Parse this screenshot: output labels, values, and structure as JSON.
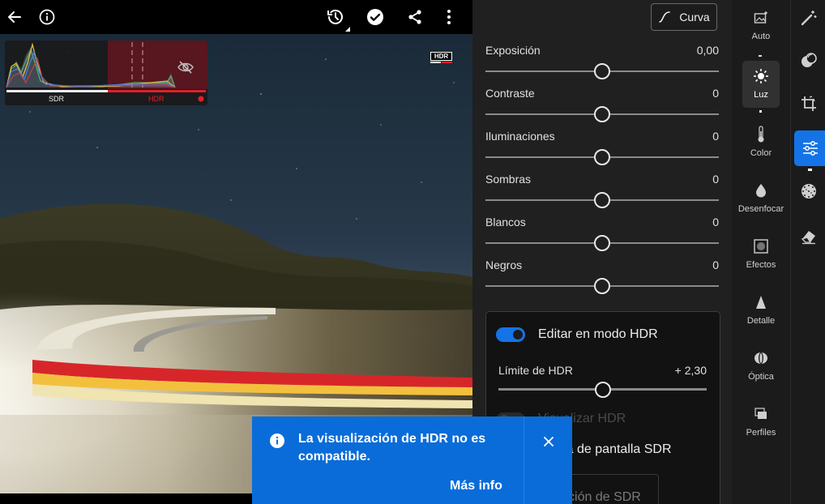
{
  "topbar": {
    "icons": [
      "back-arrow-icon",
      "info-icon",
      "history-icon",
      "check-circle-icon",
      "share-icon",
      "more-vertical-icon"
    ]
  },
  "histogram": {
    "sdr_label": "SDR",
    "hdr_label": "HDR"
  },
  "photo": {
    "hdr_badge": "HDR"
  },
  "panel": {
    "curve_button": "Curva",
    "sliders": [
      {
        "label": "Exposición",
        "value": "0,00",
        "position": 0.5
      },
      {
        "label": "Contraste",
        "value": "0",
        "position": 0.5
      },
      {
        "label": "Iluminaciones",
        "value": "0",
        "position": 0.5
      },
      {
        "label": "Sombras",
        "value": "0",
        "position": 0.5
      },
      {
        "label": "Blancos",
        "value": "0",
        "position": 0.5
      },
      {
        "label": "Negros",
        "value": "0",
        "position": 0.5
      }
    ],
    "hdr_section": {
      "edit_toggle_label": "Editar en modo HDR",
      "edit_toggle_on": true,
      "limit_label": "Límite de HDR",
      "limit_value": "+ 2,30",
      "limit_position": 0.5,
      "visualize_label": "Visualizar HDR",
      "preview_label": "previa de pantalla SDR",
      "preview_button": "ación de SDR"
    }
  },
  "tool_strip": {
    "items": [
      {
        "label": "Auto",
        "icon": "auto-photo-icon",
        "active": false
      },
      {
        "label": "Luz",
        "icon": "sun-icon",
        "active": true
      },
      {
        "label": "Color",
        "icon": "thermometer-icon",
        "active": false
      },
      {
        "label": "Desenfocar",
        "icon": "droplet-icon",
        "active": false
      },
      {
        "label": "Efectos",
        "icon": "vignette-icon",
        "active": false
      },
      {
        "label": "Detalle",
        "icon": "triangle-icon",
        "active": false
      },
      {
        "label": "Óptica",
        "icon": "lens-icon",
        "active": false
      },
      {
        "label": "Perfiles",
        "icon": "profiles-icon",
        "active": false
      }
    ]
  },
  "rail": {
    "icons": [
      "magic-wand-icon",
      "masking-icon",
      "crop-icon",
      "edit-sliders-icon",
      "presets-icon",
      "eraser-icon"
    ],
    "active_index": 3
  },
  "toast": {
    "message": "La visualización de HDR no es compatible.",
    "link": "Más info",
    "colors": {
      "background": "#0a6cd9"
    }
  },
  "colors": {
    "accent": "#1473e6",
    "hdr_red": "#e0202a"
  }
}
